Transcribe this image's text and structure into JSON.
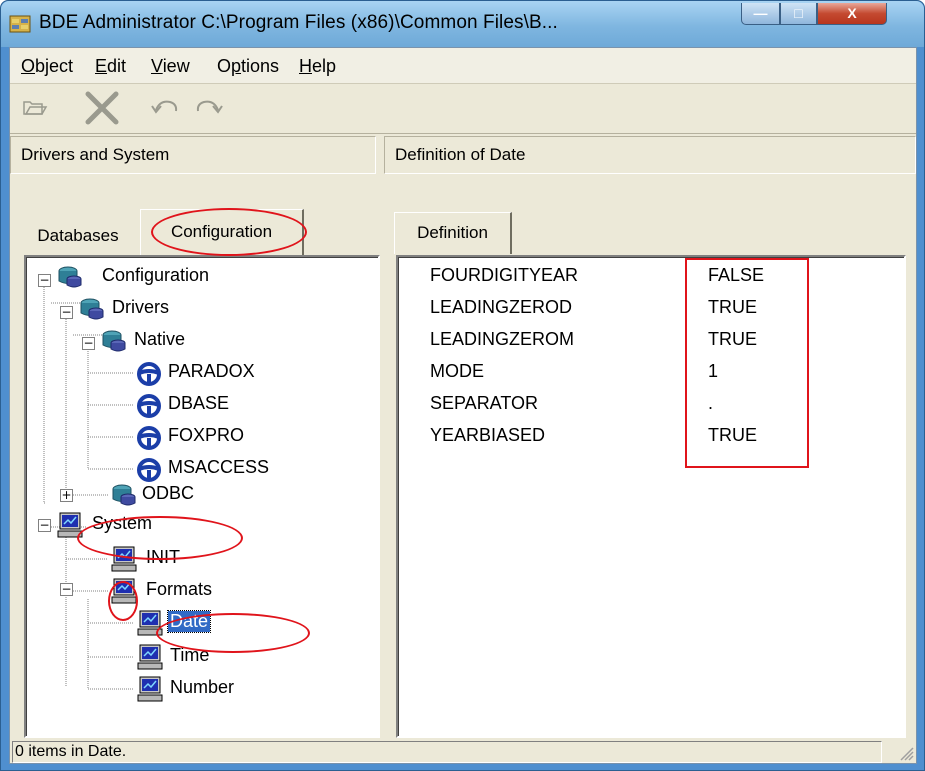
{
  "window": {
    "title": "BDE Administrator  C:\\Program Files (x86)\\Common Files\\B...",
    "buttons": {
      "minimize": "—",
      "maximize": "□",
      "close": "X"
    }
  },
  "menu": {
    "items": [
      {
        "key": "object",
        "label": "Object",
        "underline": "O"
      },
      {
        "key": "edit",
        "label": "Edit",
        "underline": "E"
      },
      {
        "key": "view",
        "label": "View",
        "underline": "V"
      },
      {
        "key": "options",
        "label": "Options",
        "underline": "p"
      },
      {
        "key": "help",
        "label": "Help",
        "underline": "H"
      }
    ]
  },
  "toolbar": {
    "icons": [
      "open-folder-icon",
      "delete-icon",
      "undo-icon",
      "redo-icon"
    ]
  },
  "left_pane": {
    "header": "Drivers and System",
    "tabs": [
      "Databases",
      "Configuration"
    ],
    "active_tab": "Configuration"
  },
  "tree": {
    "configuration": "Configuration",
    "drivers": "Drivers",
    "native": "Native",
    "paradox": "PARADOX",
    "dbase": "DBASE",
    "foxpro": "FOXPRO",
    "msaccess": "MSACCESS",
    "odbc": "ODBC",
    "system": "System",
    "init": "INIT",
    "formats": "Formats",
    "date": "Date",
    "time": "Time",
    "number": "Number",
    "selected": "Date"
  },
  "right_pane": {
    "header": "Definition of Date",
    "tab": "Definition",
    "properties": [
      {
        "name": "FOURDIGITYEAR",
        "value": "FALSE"
      },
      {
        "name": "LEADINGZEROD",
        "value": "TRUE"
      },
      {
        "name": "LEADINGZEROM",
        "value": "TRUE"
      },
      {
        "name": "MODE",
        "value": "1"
      },
      {
        "name": "SEPARATOR",
        "value": "."
      },
      {
        "name": "YEARBIASED",
        "value": "TRUE"
      }
    ]
  },
  "status": {
    "text": "0 items in Date."
  },
  "colors": {
    "title_bar": "#7fb6e0",
    "face": "#ece9d8",
    "selection": "#316ac5",
    "annotation": "#e0141b",
    "close_button": "#c44a31"
  }
}
